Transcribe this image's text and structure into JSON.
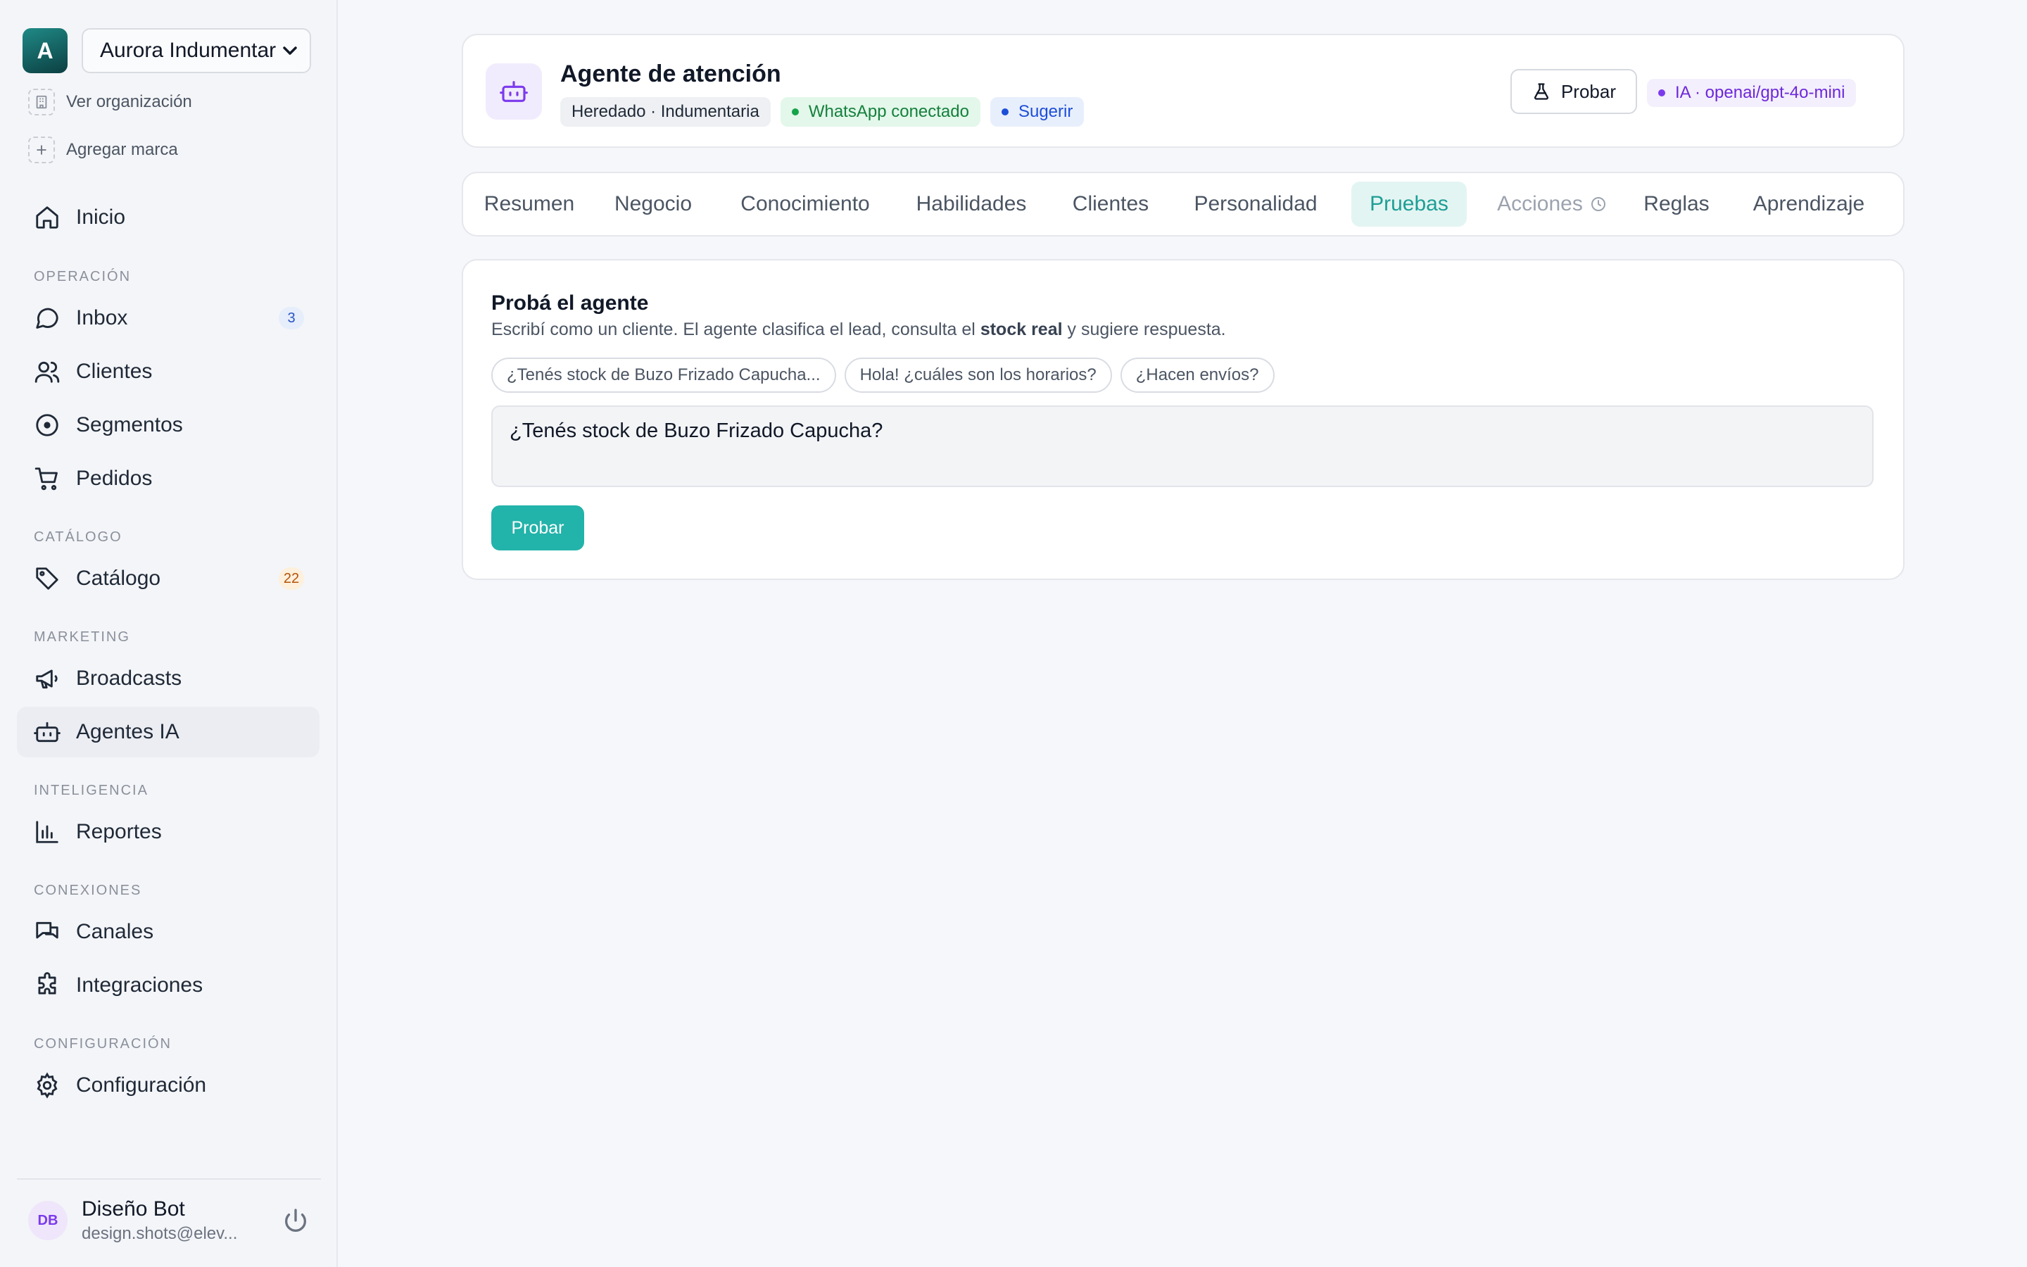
{
  "sidebar": {
    "org_initial": "A",
    "org_name": "Aurora Indumentaria",
    "view_org": "Ver organización",
    "add_brand": "Agregar marca",
    "inicio": "Inicio",
    "sections": {
      "operacion": "OPERACIÓN",
      "catalogo": "CATÁLOGO",
      "marketing": "MARKETING",
      "inteligencia": "INTELIGENCIA",
      "conexiones": "CONEXIONES",
      "configuracion": "CONFIGURACIÓN"
    },
    "items": {
      "inbox": "Inbox",
      "inbox_count": "3",
      "clientes": "Clientes",
      "segmentos": "Segmentos",
      "pedidos": "Pedidos",
      "catalogo": "Catálogo",
      "catalogo_count": "22",
      "broadcasts": "Broadcasts",
      "agentes": "Agentes IA",
      "reportes": "Reportes",
      "canales": "Canales",
      "integraciones": "Integraciones",
      "configuracion": "Configuración"
    },
    "user": {
      "initials": "DB",
      "name": "Diseño Bot",
      "email": "design.shots@elev..."
    }
  },
  "agent": {
    "title": "Agente de atención",
    "chip_inherited": "Heredado · Indumentaria",
    "chip_whatsapp": "WhatsApp conectado",
    "chip_mode": "Sugerir",
    "test_button": "Probar",
    "model": "IA · openai/gpt-4o-mini"
  },
  "tabs": {
    "resumen": "Resumen",
    "negocio": "Negocio",
    "conocimiento": "Conocimiento",
    "habilidades": "Habilidades",
    "clientes": "Clientes",
    "personalidad": "Personalidad",
    "pruebas": "Pruebas",
    "acciones": "Acciones",
    "reglas": "Reglas",
    "aprendizaje": "Aprendizaje"
  },
  "test": {
    "title": "Probá el agente",
    "desc_before": "Escribí como un cliente. El agente clasifica el lead, consulta el ",
    "desc_bold": "stock real",
    "desc_after": " y sugiere respuesta.",
    "suggestions": [
      "¿Tenés stock de Buzo Frizado Capucha...",
      "Hola! ¿cuáles son los horarios?",
      "¿Hacen envíos?"
    ],
    "input_value": "¿Tenés stock de Buzo Frizado Capucha?",
    "submit": "Probar"
  },
  "colors": {
    "accent": "#22b3aa",
    "whatsapp_green": "#15803d",
    "model_purple": "#7c3aed"
  }
}
